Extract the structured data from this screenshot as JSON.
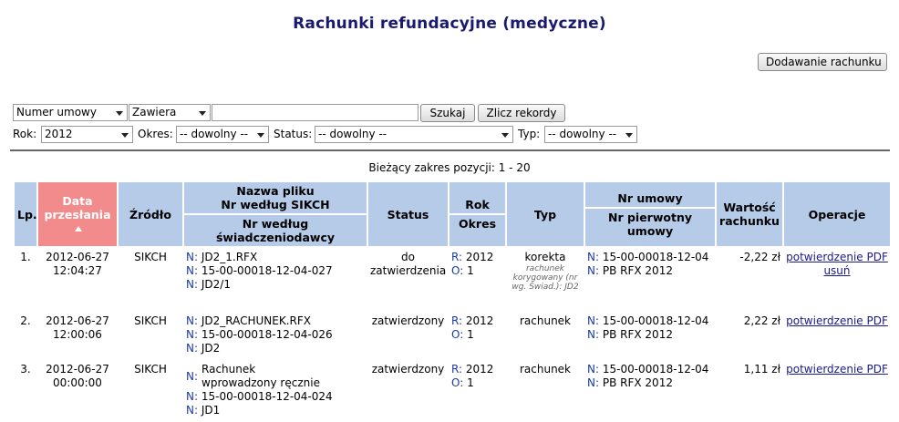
{
  "page": {
    "title": "Rachunki refundacyjne (medyczne)",
    "add_button": "Dodawanie rachunku"
  },
  "search": {
    "field_select": "Numer umowy",
    "operator_select": "Zawiera",
    "query_value": "",
    "search_button": "Szukaj",
    "count_button": "Zlicz rekordy"
  },
  "filters": {
    "year_label": "Rok:",
    "year_value": "2012",
    "period_label": "Okres:",
    "period_value": "-- dowolny --",
    "status_label": "Status:",
    "status_value": "-- dowolny --",
    "type_label": "Typ:",
    "type_value": "-- dowolny --"
  },
  "range_text": "Bieżący zakres pozycji: 1 - 20",
  "table": {
    "headers": {
      "lp": "Lp.",
      "date": "Data przesłania",
      "source": "Źródło",
      "file": "Nazwa pliku",
      "nr_sikch": "Nr według SIKCH",
      "nr_provider": "Nr według świadczeniodawcy",
      "status": "Status",
      "year": "Rok",
      "period": "Okres",
      "type": "Typ",
      "contract": "Nr umowy",
      "original_contract": "Nr pierwotny umowy",
      "value": "Wartość rachunku",
      "ops": "Operacje"
    },
    "prefixes": {
      "n": "N:",
      "r": "R:",
      "o": "O:"
    },
    "rows": [
      {
        "lp": "1.",
        "date": "2012-06-27",
        "time": "12:04:27",
        "source": "SIKCH",
        "file": "JD2_1.RFX",
        "nr_sikch": "15-00-00018-12-04-027",
        "nr_provider": "JD2/1",
        "status": "do zatwierdzenia",
        "year": "2012",
        "period": "1",
        "type": "korekta",
        "type_note": "rachunek korygowany (nr wg. Świad.): JD2",
        "contract": "15-00-00018-12-04",
        "original_contract": "PB RFX 2012",
        "value": "-2,22 zł",
        "op1": "potwierdzenie PDF",
        "op2": "usuń"
      },
      {
        "lp": "2.",
        "date": "2012-06-27",
        "time": "12:00:06",
        "source": "SIKCH",
        "file": "JD2_RACHUNEK.RFX",
        "nr_sikch": "15-00-00018-12-04-026",
        "nr_provider": "JD2",
        "status": "zatwierdzony",
        "year": "2012",
        "period": "1",
        "type": "rachunek",
        "contract": "15-00-00018-12-04",
        "original_contract": "PB RFX 2012",
        "value": "2,22 zł",
        "op1": "potwierdzenie PDF"
      },
      {
        "lp": "3.",
        "date": "2012-06-27",
        "time": "00:00:00",
        "source": "SIKCH",
        "file": "Rachunek wprowadzony ręcznie",
        "nr_sikch": "15-00-00018-12-04-024",
        "nr_provider": "JD1",
        "status": "zatwierdzony",
        "year": "2012",
        "period": "1",
        "type": "rachunek",
        "contract": "15-00-00018-12-04",
        "original_contract": "PB RFX 2012",
        "value": "1,11 zł",
        "op1": "potwierdzenie PDF"
      }
    ]
  },
  "colors": {
    "header_bg": "#b5cbe8",
    "sorted_header_bg": "#f28c8c",
    "title_color": "#1a1a6e"
  }
}
